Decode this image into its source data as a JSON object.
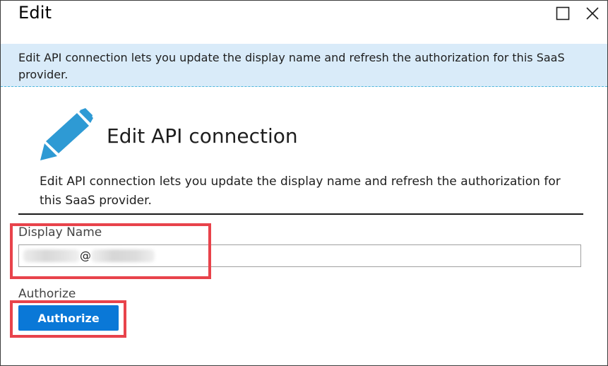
{
  "window": {
    "title": "Edit",
    "maximize_icon": "maximize-icon",
    "close_icon": "close-icon"
  },
  "banner": {
    "text": "Edit API connection lets you update the display name and refresh the authorization for this SaaS provider."
  },
  "section": {
    "icon": "pencil-icon",
    "heading": "Edit API connection",
    "description": "Edit API connection lets you update the display name and refresh the authorization for this SaaS provider."
  },
  "form": {
    "display_name_label": "Display Name",
    "display_name_at": "@",
    "authorize_label": "Authorize",
    "authorize_button": "Authorize"
  },
  "colors": {
    "banner_bg": "#d9ebf9",
    "button_bg": "#0a78d7",
    "pencil": "#2e9ad4",
    "highlight": "#e8434b"
  }
}
